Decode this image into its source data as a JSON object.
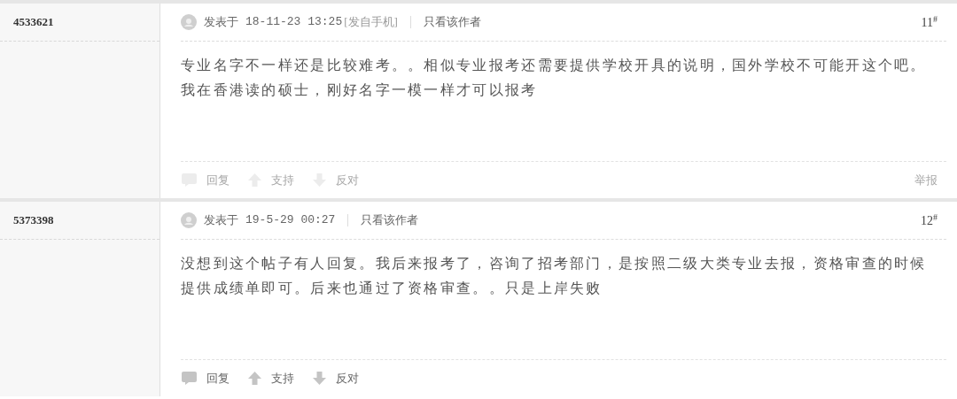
{
  "posts": [
    {
      "author": "4533621",
      "posted_label": "发表于",
      "time": "18-11-23 13:25",
      "source": "[发自手机]",
      "only_author": "只看该作者",
      "floor": "11",
      "floor_mark": "#",
      "body": "专业名字不一样还是比较难考。。相似专业报考还需要提供学校开具的说明，国外学校不可能开这个吧。我在香港读的硕士，刚好名字一模一样才可以报考",
      "actions_dimmed": true,
      "actions": [
        {
          "kind": "reply",
          "label": "回复"
        },
        {
          "kind": "up",
          "label": "支持"
        },
        {
          "kind": "down",
          "label": "反对"
        }
      ],
      "report": "举报"
    },
    {
      "author": "5373398",
      "posted_label": "发表于",
      "time": "19-5-29 00:27",
      "only_author": "只看该作者",
      "floor": "12",
      "floor_mark": "#",
      "body": "没想到这个帖子有人回复。我后来报考了，咨询了招考部门，是按照二级大类专业去报，资格审查的时候提供成绩单即可。后来也通过了资格审查。。只是上岸失败",
      "actions_dimmed": false,
      "actions": [
        {
          "kind": "reply",
          "label": "回复"
        },
        {
          "kind": "up",
          "label": "支持"
        },
        {
          "kind": "down",
          "label": "反对"
        }
      ]
    }
  ]
}
